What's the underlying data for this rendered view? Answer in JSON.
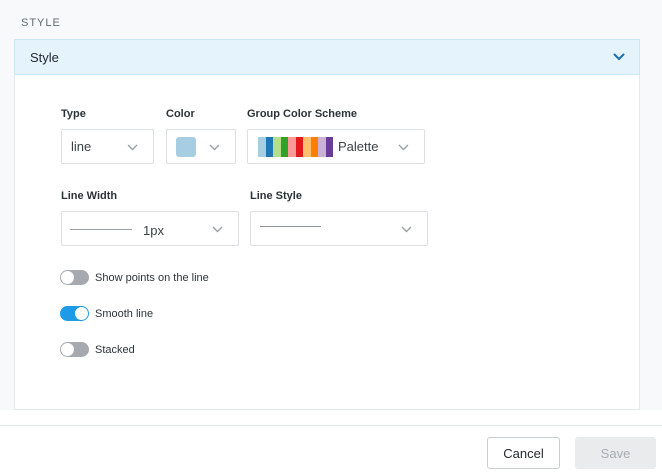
{
  "section": {
    "label": "STYLE"
  },
  "accordion": {
    "title": "Style",
    "icon": "chevron-down-icon",
    "accent": "#1a6fb3"
  },
  "type_field": {
    "label": "Type",
    "value": "line"
  },
  "color_field": {
    "label": "Color",
    "swatch": "#a6cde2"
  },
  "scheme_field": {
    "label": "Group Color Scheme",
    "value": "Palette",
    "colors": [
      "#a6cee3",
      "#1f78b4",
      "#b2df8a",
      "#33a02c",
      "#fb9a99",
      "#e31a1c",
      "#fdbf6f",
      "#ff7f00",
      "#cab2d6",
      "#6a3d9a"
    ]
  },
  "line_width_field": {
    "label": "Line Width",
    "value": "1px"
  },
  "line_style_field": {
    "label": "Line Style"
  },
  "toggles": {
    "show_points": {
      "label": "Show points on the line",
      "on": false
    },
    "smooth_line": {
      "label": "Smooth line",
      "on": true
    },
    "stacked": {
      "label": "Stacked",
      "on": false
    }
  },
  "footer": {
    "cancel_label": "Cancel",
    "save_label": "Save"
  }
}
